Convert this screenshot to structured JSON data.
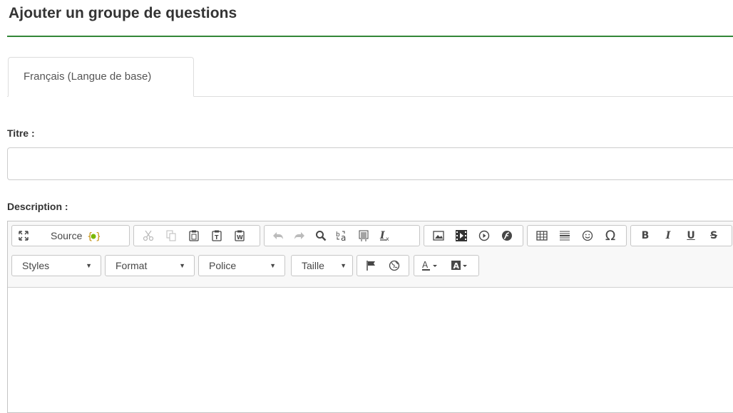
{
  "page": {
    "title": "Ajouter un groupe de questions",
    "tab_label": "Français (Langue de base)"
  },
  "form": {
    "title_label": "Titre :",
    "title_value": "",
    "description_label": "Description :"
  },
  "editor": {
    "source_label": "Source",
    "combos": {
      "styles": "Styles",
      "format": "Format",
      "police": "Police",
      "taille": "Taille"
    },
    "bold": "B",
    "italic": "I",
    "underline": "U",
    "strike": "S",
    "omega": "Ω"
  },
  "colors": {
    "accent": "#328637",
    "border": "#c6c6c6",
    "toolbar_bg": "#f8f8f8"
  }
}
